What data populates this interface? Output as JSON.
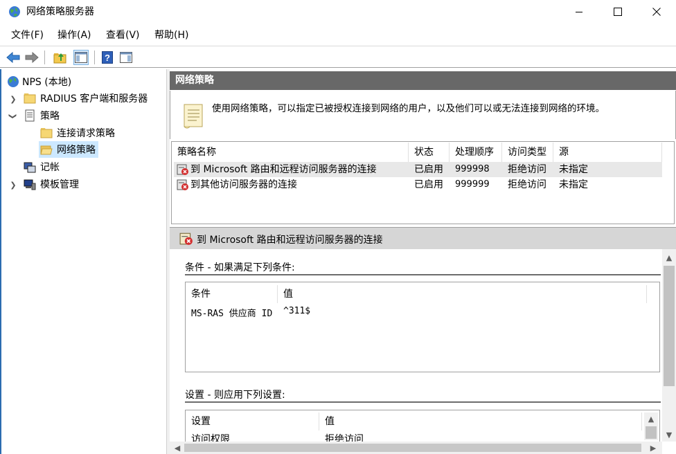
{
  "window": {
    "title": "网络策略服务器"
  },
  "menu": [
    "文件(F)",
    "操作(A)",
    "查看(V)",
    "帮助(H)"
  ],
  "tree": {
    "root": "NPS (本地)",
    "radius": "RADIUS 客户端和服务器",
    "policies": "策略",
    "conn_req": "连接请求策略",
    "network_policies": "网络策略",
    "accounting": "记帐",
    "templates": "模板管理"
  },
  "pane": {
    "header": "网络策略",
    "description": "使用网络策略，可以指定已被授权连接到网络的用户，以及他们可以或无法连接到网络的环境。"
  },
  "policy_table": {
    "columns": [
      "策略名称",
      "状态",
      "处理顺序",
      "访问类型",
      "源"
    ],
    "rows": [
      {
        "name": "到 Microsoft 路由和远程访问服务器的连接",
        "status": "已启用",
        "order": "999998",
        "access": "拒绝访问",
        "source": "未指定"
      },
      {
        "name": "到其他访问服务器的连接",
        "status": "已启用",
        "order": "999999",
        "access": "拒绝访问",
        "source": "未指定"
      }
    ]
  },
  "detail": {
    "title": "到 Microsoft 路由和远程访问服务器的连接",
    "conditions_title": "条件 - 如果满足下列条件:",
    "conditions_columns": [
      "条件",
      "值"
    ],
    "conditions_rows": [
      {
        "name": "MS-RAS 供应商 ID",
        "value": "^311$"
      }
    ],
    "settings_title": "设置 - 则应用下列设置:",
    "settings_columns": [
      "设置",
      "值"
    ],
    "settings_rows": [
      {
        "name": "访问权限",
        "value": "拒绝访问"
      }
    ]
  }
}
